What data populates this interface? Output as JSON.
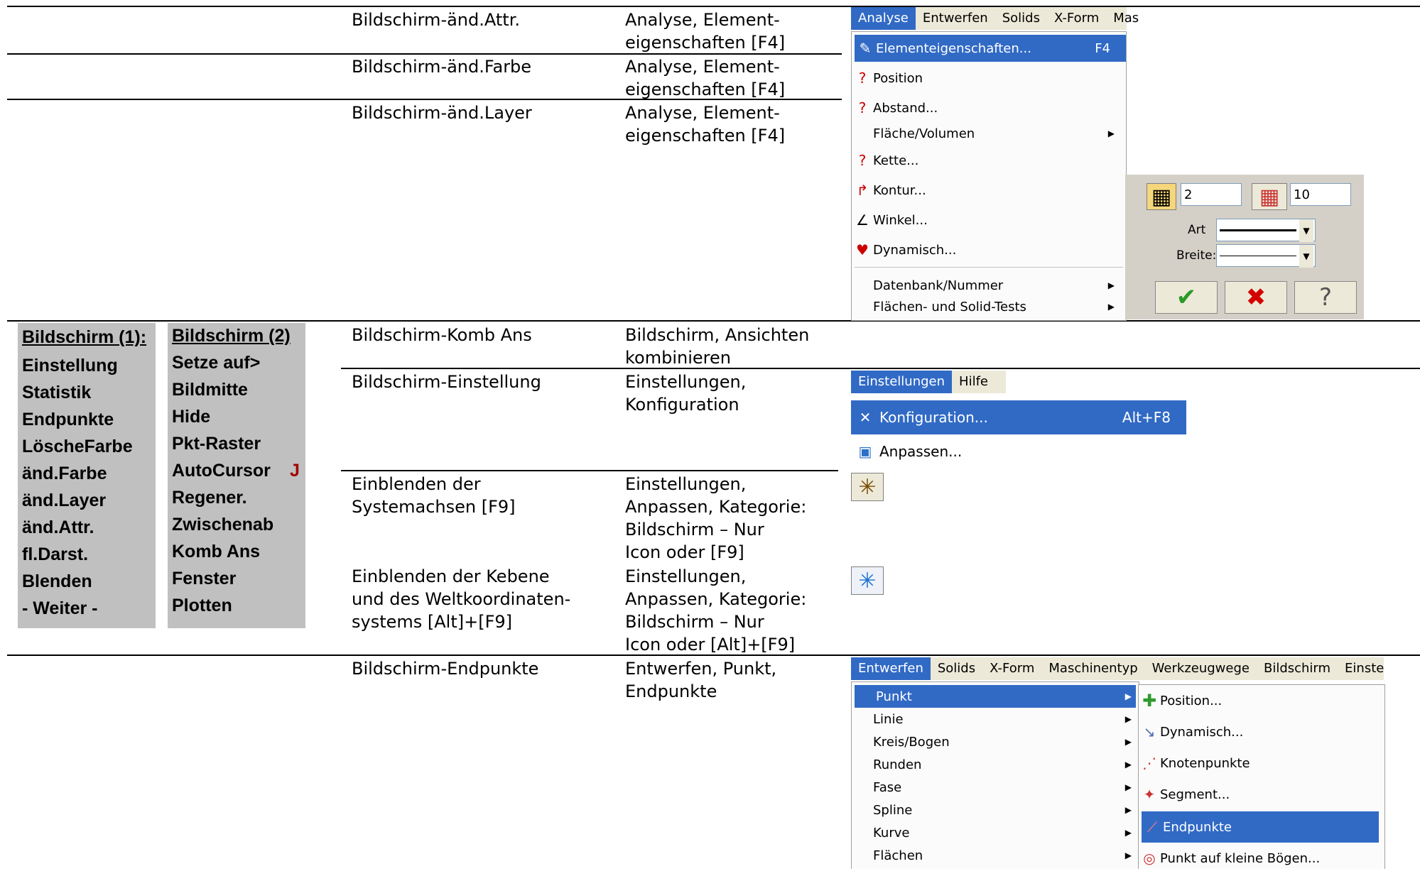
{
  "rows": [
    {
      "cmd": "Bildschirm-änd.Attr.",
      "path": "Analyse, Element-\neigenschaften [F4]"
    },
    {
      "cmd": "Bildschirm-änd.Farbe",
      "path": "Analyse, Element-\neigenschaften [F4]"
    },
    {
      "cmd": "Bildschirm-änd.Layer",
      "path": "Analyse, Element-\neigenschaften [F4]"
    },
    {
      "cmd": "Bildschirm-Komb Ans",
      "path": "Bildschirm, Ansichten\nkombinieren"
    },
    {
      "cmd": "Bildschirm-Einstellung",
      "path": "Einstellungen,\nKonfiguration"
    },
    {
      "cmd": "Einblenden der\nSystemachsen [F9]",
      "path": "Einstellungen,\nAnpassen, Kategorie:\nBildschirm – Nur\nIcon oder [F9]"
    },
    {
      "cmd": "Einblenden der Kebene\nund des Weltkoordinaten-\nsystems [Alt]+[F9]",
      "path": "Einstellungen,\nAnpassen, Kategorie:\nBildschirm – Nur\nIcon oder [Alt]+[F9]"
    },
    {
      "cmd": "Bildschirm-Endpunkte",
      "path": "Entwerfen, Punkt,\nEndpunkte"
    }
  ],
  "analyse_menu": {
    "bar": [
      "Analyse",
      "Entwerfen",
      "Solids",
      "X-Form",
      "Mas"
    ],
    "items": [
      {
        "icon": "element-properties-icon",
        "label": "Elementeigenschaften...",
        "shortcut": "F4"
      },
      {
        "icon": "position-icon",
        "label": "Position",
        "shortcut": ""
      },
      {
        "icon": "distance-icon",
        "label": "Abstand...",
        "shortcut": ""
      },
      {
        "icon": "",
        "label": "Fläche/Volumen",
        "shortcut": ""
      },
      {
        "icon": "chain-icon",
        "label": "Kette...",
        "shortcut": ""
      },
      {
        "icon": "contour-icon",
        "label": "Kontur...",
        "shortcut": ""
      },
      {
        "icon": "angle-icon",
        "label": "Winkel...",
        "shortcut": ""
      },
      {
        "icon": "dynamic-icon",
        "label": "Dynamisch...",
        "shortcut": ""
      },
      {
        "icon": "",
        "label": "Datenbank/Nummer",
        "shortcut": ""
      },
      {
        "icon": "",
        "label": "Flächen- und Solid-Tests",
        "shortcut": ""
      }
    ]
  },
  "attr_dialog": {
    "level_value": "2",
    "color_value": "10",
    "art_label": "Art",
    "breite_label": "Breite:",
    "ok": "✔",
    "cancel": "✖",
    "help": "?"
  },
  "bildschirm_menus": {
    "col1": [
      "Bildschirm (1):",
      "Einstellung",
      "Statistik",
      "Endpunkte",
      "LöscheFarbe",
      "änd.Farbe",
      "änd.Layer",
      "änd.Attr.",
      "fl.Darst.",
      "Blenden",
      "- Weiter -"
    ],
    "col2": [
      "Bildschirm (2)",
      "Setze auf>",
      "Bildmitte",
      "Hide",
      "Pkt-Raster",
      "AutoCursor",
      "Regener.",
      "Zwischenab",
      "Komb Ans",
      "Fenster",
      "Plotten"
    ],
    "autocursor_key": "J"
  },
  "einstellungen_menu": {
    "bar": [
      "Einstellungen",
      "Hilfe"
    ],
    "items": [
      {
        "icon": "configuration-icon",
        "label": "Konfiguration...",
        "shortcut": "Alt+F8"
      },
      {
        "icon": "customize-icon",
        "label": "Anpassen...",
        "shortcut": ""
      }
    ]
  },
  "entwerfen_menu": {
    "bar": [
      "Entwerfen",
      "Solids",
      "X-Form",
      "Maschinentyp",
      "Werkzeugwege",
      "Bildschirm",
      "Einste"
    ],
    "items": [
      "Punkt",
      "Linie",
      "Kreis/Bogen",
      "Runden",
      "Fase",
      "Spline",
      "Kurve",
      "Flächen"
    ],
    "submenu": [
      "Position...",
      "Dynamisch...",
      "Knotenpunkte",
      "Segment...",
      "Endpunkte",
      "Punkt auf kleine Bögen..."
    ]
  },
  "colors": {
    "highlight": "#316ac5",
    "menubar": "#ece9d8",
    "panel": "#c0c0c0"
  }
}
